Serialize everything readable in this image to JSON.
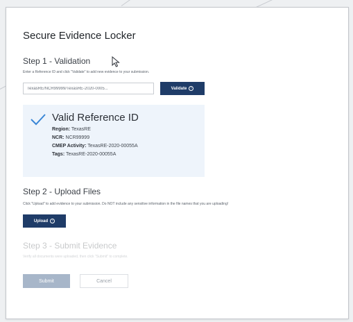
{
  "page": {
    "title": "Secure Evidence Locker"
  },
  "step1": {
    "title": "Step 1 - Validation",
    "hint": "Enter a Reference ID and click \"Validate\" to add new evidence to your submission.",
    "input_value": "TexasRE/NCR99999/TexasRE-2020-0005...",
    "validate_label": "Validate"
  },
  "validation": {
    "title": "Valid Reference ID",
    "details": [
      {
        "label": "Region:",
        "value": "TexasRE"
      },
      {
        "label": "NCR:",
        "value": "NCR99999"
      },
      {
        "label": "CMEP Activity:",
        "value": "TexasRE-2020-00055A"
      },
      {
        "label": "Tags:",
        "value": "TexasRE-2020-00055A"
      }
    ],
    "accent": "#3a86d6"
  },
  "step2": {
    "title": "Step 2 - Upload Files",
    "hint": "Click \"Upload\" to add evidence to your submission. Do NOT include any sensitive information in the file names that you are uploading!",
    "upload_label": "Upload"
  },
  "step3": {
    "title": "Step 3 - Submit Evidence",
    "hint": "Verify all documents were uploaded, then click \"Submit\" to complete.",
    "submit_label": "Submit",
    "cancel_label": "Cancel"
  },
  "colors": {
    "primary_button": "#1f3c68",
    "disabled_button": "#a7b6c9",
    "panel_bg": "#eef4fb"
  },
  "icons": {
    "cursor": "mouse-pointer-icon",
    "check": "checkmark-icon",
    "button_icon": "circle-arrow-icon"
  }
}
